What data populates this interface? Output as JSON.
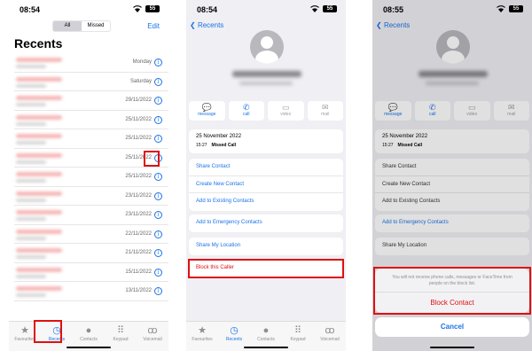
{
  "panel1": {
    "time": "08:54",
    "battery": "55",
    "segment": {
      "all": "All",
      "missed": "Missed"
    },
    "edit_label": "Edit",
    "title": "Recents",
    "rows": [
      {
        "date": "Monday"
      },
      {
        "date": "Saturday"
      },
      {
        "date": "29/11/2022"
      },
      {
        "date": "25/11/2022"
      },
      {
        "date": "25/11/2022"
      },
      {
        "date": "25/11/2022"
      },
      {
        "date": "25/11/2022"
      },
      {
        "date": "23/11/2022"
      },
      {
        "date": "23/11/2022"
      },
      {
        "date": "22/11/2022"
      },
      {
        "date": "21/11/2022"
      },
      {
        "date": "15/11/2022"
      },
      {
        "date": "13/11/2022"
      }
    ]
  },
  "tabbar": {
    "favourites": "Favourites",
    "recents": "Recents",
    "contacts": "Contacts",
    "keypad": "Keypad",
    "voicemail": "Voicemail"
  },
  "panel2": {
    "time": "08:54",
    "battery": "55",
    "back_label": "Recents",
    "actions": {
      "message": "message",
      "call": "call",
      "video": "video",
      "mail": "mail"
    },
    "call_date": "25 November 2022",
    "call_time": "15:27",
    "call_type": "Missed Call",
    "menu": {
      "share_contact": "Share Contact",
      "create_new_contact": "Create New Contact",
      "add_existing": "Add to Existing Contacts",
      "emergency": "Add to Emergency Contacts",
      "share_location": "Share My Location",
      "block": "Block this Caller"
    }
  },
  "panel3": {
    "time": "08:55",
    "battery": "55",
    "sheet_message": "You will not receive phone calls, messages or FaceTime from people on the block list.",
    "block_contact": "Block Contact",
    "cancel": "Cancel"
  },
  "colors": {
    "accent": "#1a73e8",
    "danger": "#e01010"
  }
}
